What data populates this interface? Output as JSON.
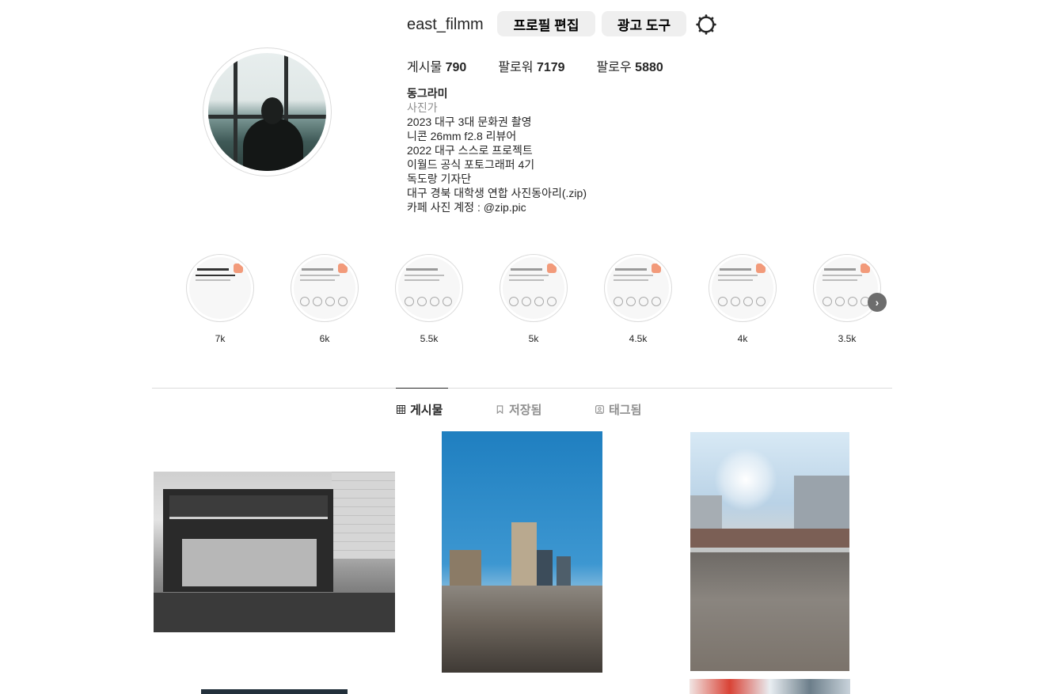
{
  "profile": {
    "username": "east_filmm",
    "edit_profile_label": "프로필 편집",
    "ad_tools_label": "광고 도구",
    "stats": [
      {
        "label": "게시물",
        "value": "790"
      },
      {
        "label": "팔로워",
        "value": "7179"
      },
      {
        "label": "팔로우",
        "value": "5880"
      }
    ],
    "bio": {
      "name": "동그라미",
      "category": "사진가",
      "lines": [
        "2023 대구 3대 문화권 촬영",
        "니콘 26mm f2.8 리뷰어",
        "2022 대구 스스로 프로젝트",
        "이월드 공식 포토그래퍼 4기",
        "독도랑 기자단",
        "대구 경북 대학생 연합 사진동아리(.zip)",
        "카페 사진 계정 : @zip.pic"
      ]
    }
  },
  "highlights": [
    {
      "label": "7k"
    },
    {
      "label": "6k"
    },
    {
      "label": "5.5k"
    },
    {
      "label": "5k"
    },
    {
      "label": "4.5k"
    },
    {
      "label": "4k"
    },
    {
      "label": "3.5k"
    }
  ],
  "tabs": [
    {
      "label": "게시물",
      "icon": "grid-icon",
      "active": true
    },
    {
      "label": "저장됨",
      "icon": "bookmark-icon",
      "active": false
    },
    {
      "label": "태그됨",
      "icon": "tag-person-icon",
      "active": false
    }
  ],
  "colors": {
    "text": "#262626",
    "muted": "#8e8e8e",
    "button_bg": "#efefef",
    "border": "#dbdbdb"
  }
}
